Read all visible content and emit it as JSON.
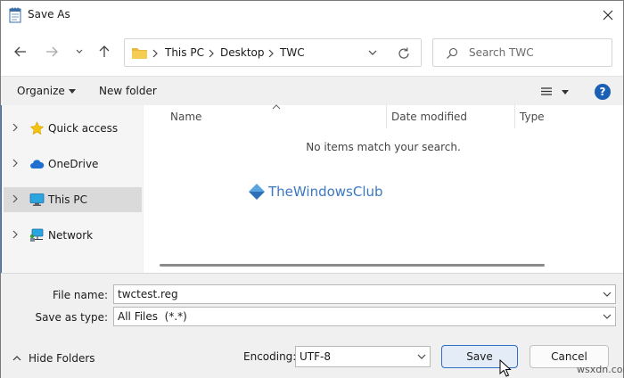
{
  "window": {
    "title": "Save As"
  },
  "address": {
    "crumbs": [
      "This PC",
      "Desktop",
      "TWC"
    ]
  },
  "search": {
    "placeholder": "Search TWC"
  },
  "toolbar": {
    "organize_label": "Organize",
    "new_folder_label": "New folder",
    "help_label": "?"
  },
  "sidebar": {
    "items": [
      {
        "label": "Quick access",
        "icon": "star-icon"
      },
      {
        "label": "OneDrive",
        "icon": "cloud-icon"
      },
      {
        "label": "This PC",
        "icon": "monitor-icon",
        "selected": true
      },
      {
        "label": "Network",
        "icon": "network-icon"
      }
    ]
  },
  "filelist": {
    "columns": [
      "Name",
      "Date modified",
      "Type"
    ],
    "empty_message": "No items match your search.",
    "watermark": "TheWindowsClub"
  },
  "form": {
    "file_name_label": "File name:",
    "file_name_value": "twctest.reg",
    "save_type_label": "Save as type:",
    "save_type_value": "All Files  (*.*)",
    "hide_folders_label": "Hide Folders",
    "encoding_label": "Encoding:",
    "encoding_value": "UTF-8",
    "save_label": "Save",
    "cancel_label": "Cancel",
    "brand": "wsxdn.com"
  },
  "colors": {
    "accent": "#2c6fc4",
    "selected_bg": "#dadada",
    "folder": "#e8b93c"
  }
}
